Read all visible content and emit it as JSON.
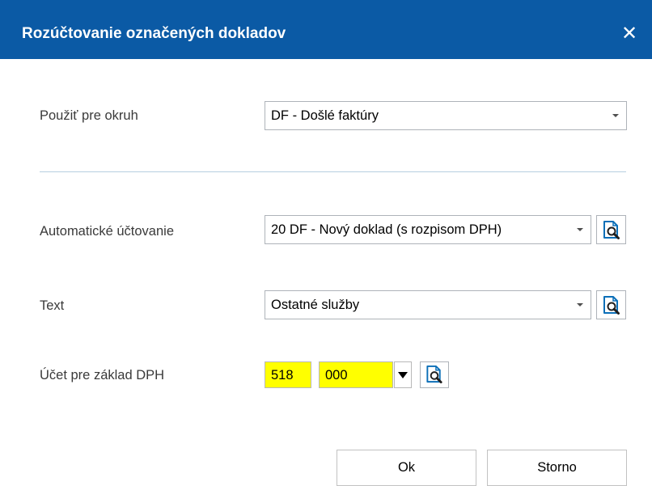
{
  "dialog": {
    "title": "Rozúčtovanie označených dokladov",
    "close_glyph": "✕"
  },
  "form": {
    "okruh": {
      "label": "Použiť pre okruh",
      "value": "DF - Došlé faktúry"
    },
    "auto": {
      "label": "Automatické účtovanie",
      "value": "20 DF - Nový doklad (s rozpisom DPH)"
    },
    "text": {
      "label": "Text",
      "value": "Ostatné služby"
    },
    "ucet": {
      "label": "Účet pre základ DPH",
      "synth": "518",
      "anal": "000"
    }
  },
  "buttons": {
    "ok": "Ok",
    "cancel": "Storno"
  },
  "colors": {
    "titlebar": "#0b5aa5",
    "highlight": "#ffff00"
  },
  "icons": {
    "lookup": "document-search-icon",
    "close": "close-icon",
    "dropdown": "chevron-down-icon"
  }
}
